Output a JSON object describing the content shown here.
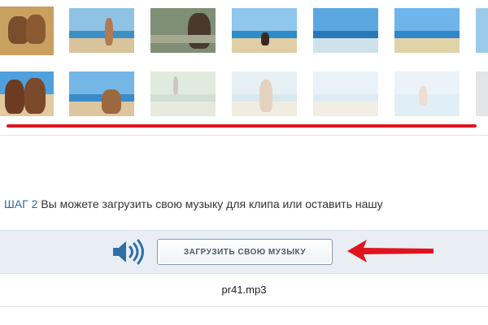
{
  "step": {
    "label": "ШАГ 2",
    "text": "Вы можете загрузить свою музыку для клипа или оставить нашу"
  },
  "music": {
    "upload_button_label": "ЗАГРУЗИТЬ СВОЮ МУЗЫКУ",
    "speaker_icon": "speaker-volume-icon",
    "arrow_icon": "red-arrow-left-icon",
    "filename": "pr41.mp3"
  },
  "colors": {
    "accent_blue": "#2b6ba4",
    "highlight_red": "#e0141e",
    "bar_background": "#e8eef3"
  }
}
